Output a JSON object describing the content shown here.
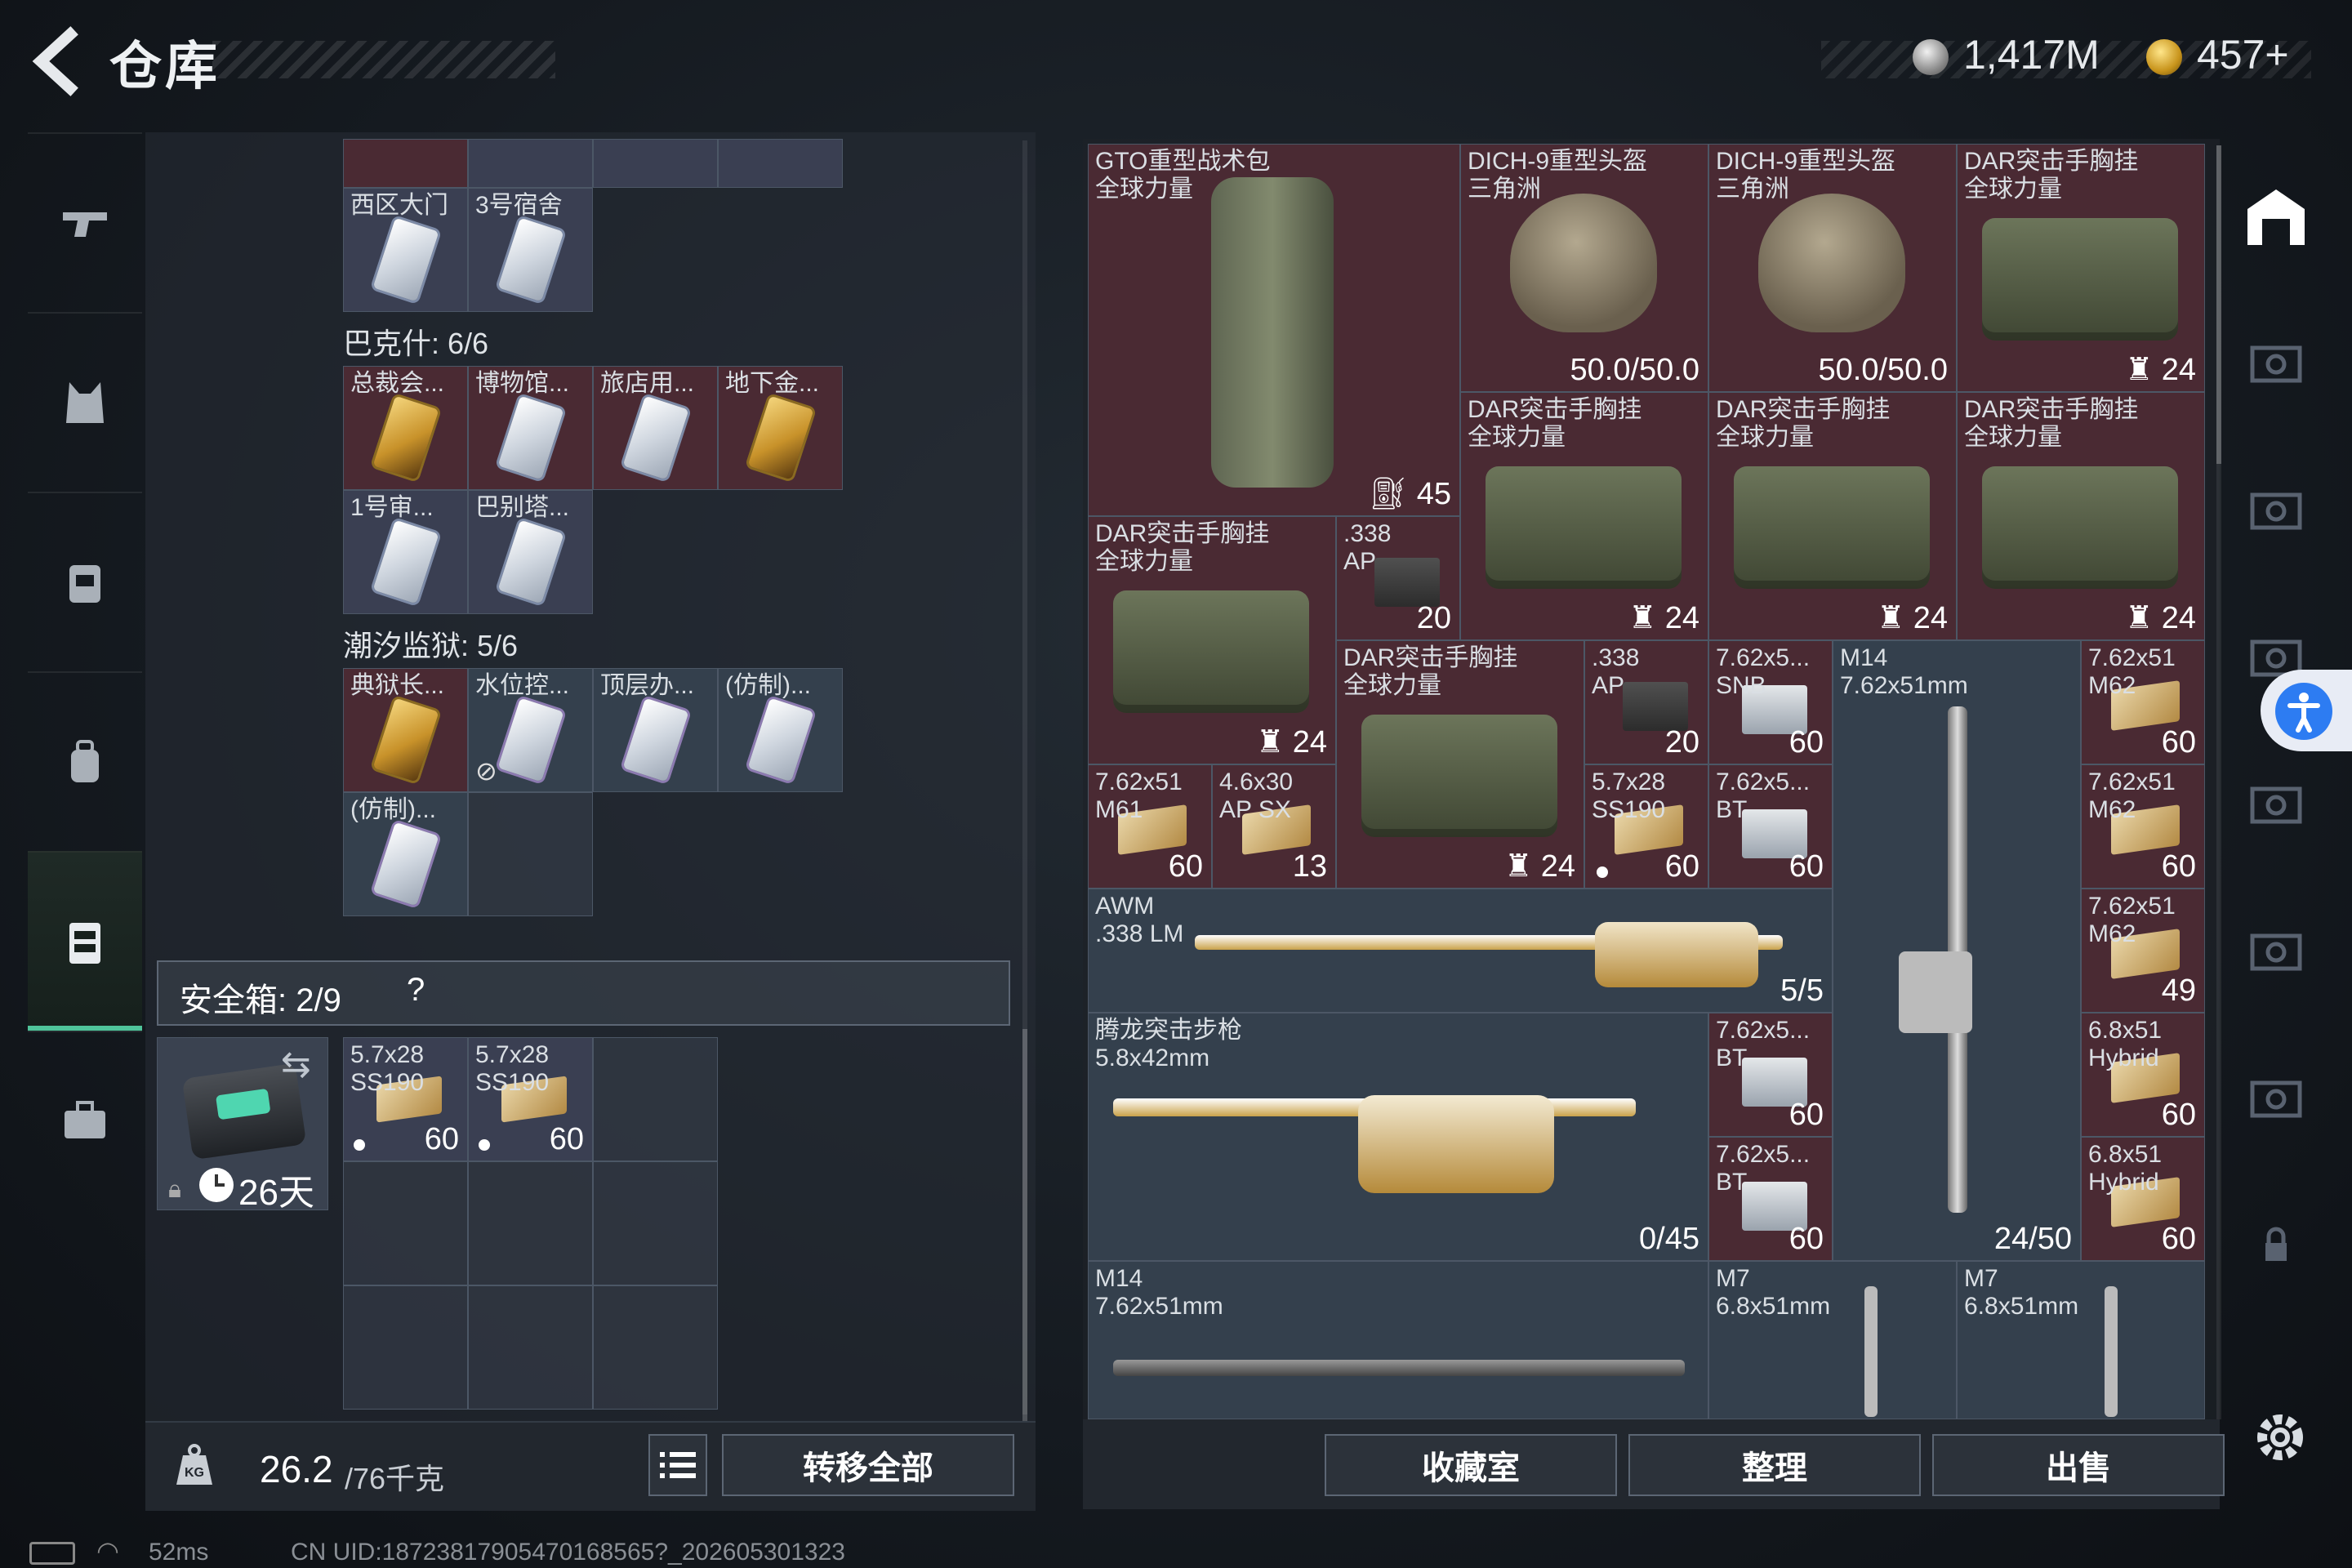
{
  "header": {
    "title": "仓库",
    "currency_silver": "1,417M",
    "currency_gold": "457+"
  },
  "left_nav": [
    "weapon-tab",
    "armor-tab",
    "backpack-tab",
    "chest-rig-tab",
    "container-tab",
    "briefcase-tab"
  ],
  "keys": {
    "top_row": [
      "西区大门",
      "3号宿舍"
    ],
    "bakesh_label": "巴克什: 6/6",
    "bakesh": [
      "总裁会...",
      "博物馆...",
      "旅店用...",
      "地下金...",
      "1号审...",
      "巴别塔..."
    ],
    "chaoxi_label": "潮汐监狱: 5/6",
    "chaoxi": [
      "典狱长...",
      "水位控...",
      "顶层办...",
      "(仿制)...",
      "(仿制)..."
    ]
  },
  "safebox": {
    "title": "安全箱: 2/9",
    "help": "?",
    "days": "26天",
    "items": [
      {
        "name": "5.7x28\nSS190",
        "count": "60"
      },
      {
        "name": "5.7x28\nSS190",
        "count": "60"
      }
    ]
  },
  "weight": {
    "value": "26.2",
    "max": "/76千克"
  },
  "buttons": {
    "transfer": "转移全部",
    "collect": "收藏室",
    "arrange": "整理",
    "sell": "出售"
  },
  "stash": {
    "gto": {
      "name": "GTO重型战术包\n全球力量",
      "count": "45"
    },
    "helmet1": {
      "name": "DICH-9重型头盔\n三角洲",
      "dur": "50.0/50.0"
    },
    "helmet2": {
      "name": "DICH-9重型头盔\n三角洲",
      "dur": "50.0/50.0"
    },
    "rig": "DAR突击手胸挂\n全球力量",
    "rig_count": "24",
    "ammo_338": ".338\nAP",
    "ammo_338_count": "20",
    "m14_title": "M14\n7.62x51mm",
    "m14_ammo": "24/50",
    "ammo_m62": "7.62x51\nM62",
    "ammo_762_snb": "7.62x5...\nSNB",
    "ammo_762_bt": "7.62x5...\nBT",
    "ammo_m61": "7.62x51\nM61",
    "ammo_46": "4.6x30\nAP SX",
    "ammo_46_count": "13",
    "ammo_57": "5.7x28\nSS190",
    "awm_title": "AWM\n.338 LM",
    "awm_ammo": "5/5",
    "tenglong_title": "腾龙突击步枪\n5.8x42mm",
    "tenglong_ammo": "0/45",
    "ammo_68": "6.8x51\nHybrid",
    "m14b_title": "M14\n7.62x51mm",
    "m7_title": "M7\n6.8x51mm",
    "n60": "60",
    "n49": "49"
  },
  "status": {
    "ping": "52ms",
    "uid": "CN UID:18723817905470168565?_202605301323"
  },
  "colors": {
    "accent": "#4fc49a",
    "red_cell": "#4a2a33",
    "access": "#2d7cf2"
  }
}
